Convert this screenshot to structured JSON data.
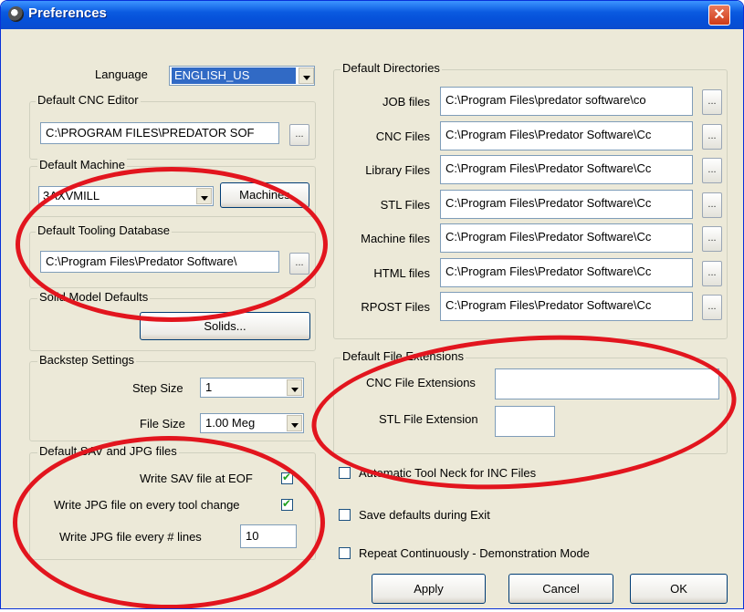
{
  "window": {
    "title": "Preferences"
  },
  "language": {
    "label": "Language",
    "value": "ENGLISH_US"
  },
  "cnc_editor": {
    "legend": "Default CNC Editor",
    "path": "C:\\PROGRAM FILES\\PREDATOR SOF",
    "browse": "..."
  },
  "machine": {
    "legend": "Default Machine",
    "value": "3AXVMILL",
    "button": "Machines"
  },
  "tooling": {
    "legend": "Default Tooling Database",
    "path": "C:\\Program Files\\Predator Software\\",
    "browse": "..."
  },
  "solids": {
    "legend": "Solid Model Defaults",
    "button": "Solids..."
  },
  "backstep": {
    "legend": "Backstep Settings",
    "step_label": "Step Size",
    "step_value": "1",
    "file_label": "File Size",
    "file_value": "1.00 Meg"
  },
  "sav_jpg": {
    "legend": "Default SAV and JPG files",
    "write_sav": "Write SAV file at EOF",
    "write_jpg_tool": "Write JPG file on every tool change",
    "write_jpg_lines": "Write JPG file every # lines",
    "lines_value": "10"
  },
  "directories": {
    "legend": "Default Directories",
    "browse": "...",
    "items": [
      {
        "label": "JOB files",
        "path": "C:\\Program Files\\predator software\\co"
      },
      {
        "label": "CNC Files",
        "path": "C:\\Program Files\\Predator Software\\Cc"
      },
      {
        "label": "Library Files",
        "path": "C:\\Program Files\\Predator Software\\Cc"
      },
      {
        "label": "STL Files",
        "path": "C:\\Program Files\\Predator Software\\Cc"
      },
      {
        "label": "Machine files",
        "path": "C:\\Program Files\\Predator Software\\Cc"
      },
      {
        "label": "HTML files",
        "path": "C:\\Program Files\\Predator Software\\Cc"
      },
      {
        "label": "RPOST Files",
        "path": "C:\\Program Files\\Predator Software\\Cc"
      }
    ]
  },
  "extensions": {
    "legend": "Default File Extensions",
    "cnc_label": "CNC File Extensions",
    "cnc_value": "",
    "stl_label": "STL File Extension",
    "stl_value": ""
  },
  "options": {
    "tool_neck": "Automatic Tool Neck for INC Files",
    "save_defaults": "Save defaults during Exit",
    "repeat": "Repeat Continuously - Demonstration Mode"
  },
  "buttons": {
    "apply": "Apply",
    "cancel": "Cancel",
    "ok": "OK"
  },
  "colors": {
    "titlebar": "#0a5ae0",
    "dialog": "#ece9d8",
    "annotation": "#e2151e"
  }
}
